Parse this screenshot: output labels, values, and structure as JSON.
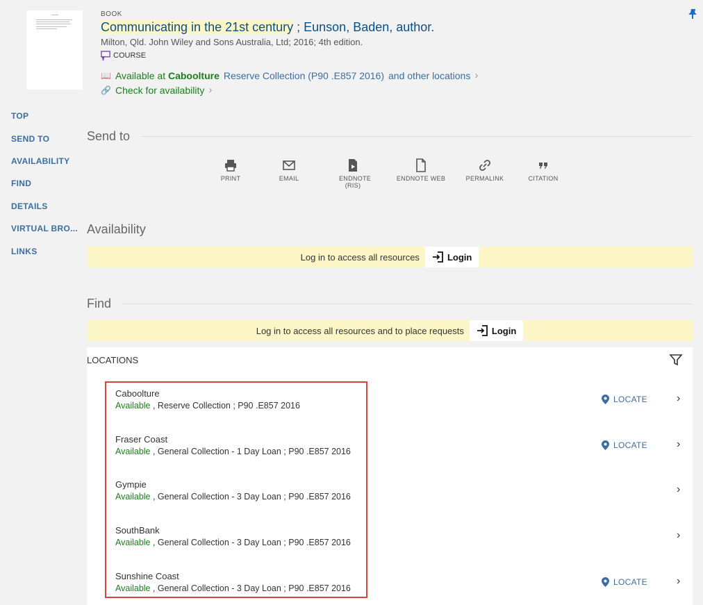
{
  "record": {
    "type": "BOOK",
    "title_main": "Communicating in the 21st century",
    "title_rest": " ; Eunson, Baden, author.",
    "publication": "Milton, Qld. John Wiley and Sons Australia, Ltd; 2016; 4th edition.",
    "course_label": "COURSE",
    "availability_prefix": "Available at",
    "availability_library": "Caboolture",
    "availability_collection": "Reserve Collection (P90 .E857 2016)",
    "availability_other": "and other locations",
    "check_label": "Check for availability"
  },
  "nav": [
    "TOP",
    "SEND TO",
    "AVAILABILITY",
    "FIND",
    "DETAILS",
    "VIRTUAL BRO...",
    "LINKS"
  ],
  "sections": {
    "send_to": "Send to",
    "availability": "Availability",
    "find": "Find"
  },
  "send_to": [
    {
      "label": "PRINT",
      "icon": "print-icon"
    },
    {
      "label": "EMAIL",
      "icon": "email-icon"
    },
    {
      "label": "ENDNOTE (RIS)",
      "icon": "endnote-icon"
    },
    {
      "label": "ENDNOTE WEB",
      "icon": "document-icon"
    },
    {
      "label": "PERMALINK",
      "icon": "link-icon"
    },
    {
      "label": "CITATION",
      "icon": "quote-icon"
    }
  ],
  "banners": {
    "availability_text": "Log in to access all resources",
    "find_text": "Log in to access all resources and to place requests",
    "login": "Login"
  },
  "locations": {
    "title": "LOCATIONS",
    "locate_label": "LOCATE",
    "items": [
      {
        "library": "Caboolture",
        "status": "Available",
        "details": " , Reserve Collection ; P90 .E857 2016",
        "locate": true
      },
      {
        "library": "Fraser Coast",
        "status": "Available",
        "details": " , General Collection - 1 Day Loan ; P90 .E857 2016",
        "locate": true
      },
      {
        "library": "Gympie",
        "status": "Available",
        "details": " , General Collection - 3 Day Loan ; P90 .E857 2016",
        "locate": false
      },
      {
        "library": "SouthBank",
        "status": "Available",
        "details": " , General Collection - 3 Day Loan ; P90 .E857 2016",
        "locate": false
      },
      {
        "library": "Sunshine Coast",
        "status": "Available",
        "details": " , General Collection - 3 Day Loan ; P90 .E857 2016",
        "locate": true
      }
    ]
  },
  "colors": {
    "link": "#3b6e9e",
    "available": "#1a7f1a",
    "highlight": "#fdf6c6",
    "callout": "#d9443a"
  }
}
